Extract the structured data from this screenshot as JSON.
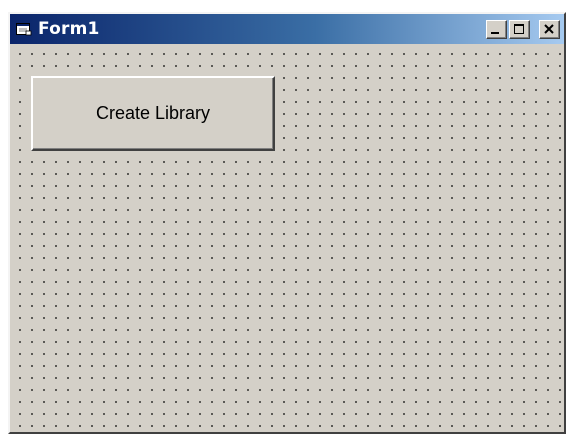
{
  "window": {
    "title": "Form1",
    "icon": "form-icon",
    "controls": {
      "minimize": "minimize-icon",
      "maximize": "maximize-icon",
      "close": "close-icon"
    }
  },
  "form": {
    "create_button_label": "Create Library"
  },
  "colors": {
    "titlebar_start": "#0a246a",
    "titlebar_end": "#a6caf0",
    "face": "#d4d0c8"
  }
}
